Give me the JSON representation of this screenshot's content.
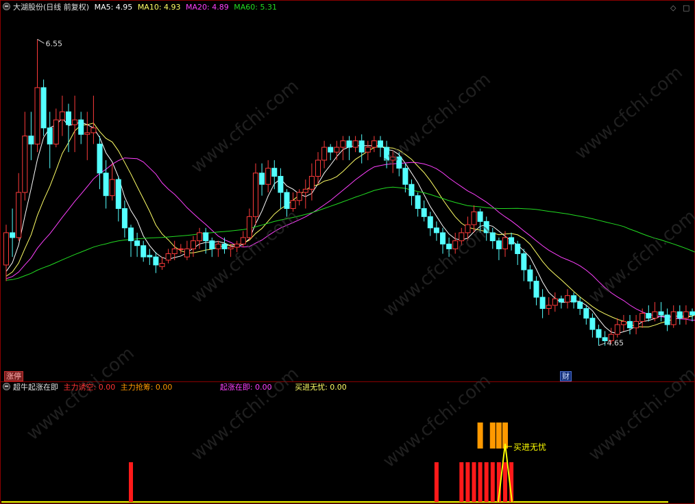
{
  "main_legend": {
    "title": "大湖股份(日线 前复权)",
    "ma5_label": "MA5: 4.95",
    "ma10_label": "MA10: 4.93",
    "ma20_label": "MA20: 4.89",
    "ma60_label": "MA60: 5.31"
  },
  "sub_legend": {
    "title": "超牛起涨在即",
    "zhuli_youkong": "主力诱空: 0.00",
    "zhuli_qiangchou": "主力抢筹: 0.00",
    "qizhang_zaiji": "起涨在即: 0.00",
    "maijin_wuyou": "买进无忧: 0.00"
  },
  "tags": {
    "zhangting": "涨停",
    "cai": "财"
  },
  "watermark": "www.cfchi.com",
  "colors": {
    "up": "#ff3b3b",
    "down": "#54ffff",
    "ma5": "#ffffff",
    "ma10": "#ffff66",
    "ma20": "#ff40ff",
    "ma60": "#22dd22",
    "red_bar": "#ff1a1a",
    "orange_bar": "#ff9900",
    "yellow_line": "#ffff00"
  },
  "chart_data": [
    {
      "type": "candlestick",
      "price_range": [
        4.5,
        6.7
      ],
      "high_label": "6.55",
      "low_label": "4.65",
      "candles": [
        [
          5.15,
          5.35,
          5.05,
          5.4
        ],
        [
          5.35,
          5.32,
          5.2,
          5.5
        ],
        [
          5.32,
          5.6,
          5.3,
          5.72
        ],
        [
          5.6,
          5.95,
          5.55,
          6.1
        ],
        [
          5.95,
          5.9,
          5.8,
          6.1
        ],
        [
          5.9,
          6.25,
          5.85,
          6.55
        ],
        [
          6.25,
          6.0,
          5.95,
          6.3
        ],
        [
          6.0,
          5.9,
          5.75,
          6.1
        ],
        [
          5.9,
          6.05,
          5.88,
          6.12
        ],
        [
          6.05,
          6.1,
          5.95,
          6.2
        ],
        [
          6.1,
          6.02,
          5.85,
          6.15
        ],
        [
          6.02,
          6.05,
          5.85,
          6.2
        ],
        [
          6.05,
          5.96,
          5.9,
          6.1
        ],
        [
          5.96,
          5.97,
          5.8,
          6.1
        ],
        [
          5.97,
          6.0,
          5.9,
          6.2
        ],
        [
          5.9,
          5.72,
          5.62,
          5.95
        ],
        [
          5.72,
          5.58,
          5.5,
          5.8
        ],
        [
          5.58,
          5.68,
          5.55,
          5.78
        ],
        [
          5.68,
          5.5,
          5.42,
          5.7
        ],
        [
          5.5,
          5.38,
          5.32,
          5.55
        ],
        [
          5.38,
          5.3,
          5.2,
          5.4
        ],
        [
          5.3,
          5.27,
          5.2,
          5.35
        ],
        [
          5.27,
          5.2,
          5.17,
          5.3
        ],
        [
          5.21,
          5.2,
          5.15,
          5.25
        ],
        [
          5.2,
          5.15,
          5.1,
          5.23
        ],
        [
          5.14,
          5.16,
          5.12,
          5.2
        ],
        [
          5.18,
          5.22,
          5.16,
          5.25
        ],
        [
          5.22,
          5.25,
          5.18,
          5.3
        ],
        [
          5.25,
          5.25,
          5.22,
          5.28
        ],
        [
          5.2,
          5.25,
          5.18,
          5.3
        ],
        [
          5.25,
          5.3,
          5.2,
          5.33
        ],
        [
          5.3,
          5.35,
          5.25,
          5.38
        ],
        [
          5.35,
          5.3,
          5.22,
          5.38
        ],
        [
          5.3,
          5.25,
          5.2,
          5.32
        ],
        [
          5.25,
          5.28,
          5.2,
          5.3
        ],
        [
          5.28,
          5.25,
          5.22,
          5.32
        ],
        [
          5.25,
          5.26,
          5.2,
          5.28
        ],
        [
          5.26,
          5.28,
          5.23,
          5.3
        ],
        [
          5.28,
          5.32,
          5.26,
          5.36
        ],
        [
          5.32,
          5.45,
          5.3,
          5.5
        ],
        [
          5.45,
          5.72,
          5.4,
          5.78
        ],
        [
          5.72,
          5.65,
          5.58,
          5.78
        ],
        [
          5.65,
          5.75,
          5.6,
          5.8
        ],
        [
          5.75,
          5.7,
          5.62,
          5.8
        ],
        [
          5.7,
          5.6,
          5.5,
          5.75
        ],
        [
          5.6,
          5.5,
          5.45,
          5.62
        ],
        [
          5.5,
          5.55,
          5.48,
          5.6
        ],
        [
          5.55,
          5.6,
          5.52,
          5.62
        ],
        [
          5.6,
          5.62,
          5.5,
          5.68
        ],
        [
          5.62,
          5.7,
          5.55,
          5.78
        ],
        [
          5.7,
          5.8,
          5.65,
          5.85
        ],
        [
          5.8,
          5.88,
          5.75,
          5.92
        ],
        [
          5.88,
          5.85,
          5.8,
          5.9
        ],
        [
          5.85,
          5.88,
          5.8,
          5.92
        ],
        [
          5.88,
          5.92,
          5.8,
          5.95
        ],
        [
          5.92,
          5.88,
          5.8,
          5.95
        ],
        [
          5.88,
          5.92,
          5.85,
          5.95
        ],
        [
          5.92,
          5.85,
          5.78,
          5.96
        ],
        [
          5.85,
          5.88,
          5.8,
          5.92
        ],
        [
          5.88,
          5.92,
          5.85,
          5.95
        ],
        [
          5.92,
          5.88,
          5.82,
          5.95
        ],
        [
          5.88,
          5.8,
          5.75,
          5.92
        ],
        [
          5.8,
          5.82,
          5.72,
          5.86
        ],
        [
          5.82,
          5.75,
          5.7,
          5.85
        ],
        [
          5.75,
          5.65,
          5.6,
          5.78
        ],
        [
          5.65,
          5.58,
          5.52,
          5.68
        ],
        [
          5.58,
          5.5,
          5.45,
          5.6
        ],
        [
          5.5,
          5.45,
          5.42,
          5.55
        ],
        [
          5.45,
          5.38,
          5.33,
          5.48
        ],
        [
          5.38,
          5.35,
          5.3,
          5.42
        ],
        [
          5.35,
          5.28,
          5.22,
          5.38
        ],
        [
          5.28,
          5.25,
          5.2,
          5.32
        ],
        [
          5.25,
          5.3,
          5.22,
          5.35
        ],
        [
          5.3,
          5.35,
          5.27,
          5.38
        ],
        [
          5.35,
          5.4,
          5.3,
          5.45
        ],
        [
          5.4,
          5.48,
          5.35,
          5.52
        ],
        [
          5.48,
          5.42,
          5.35,
          5.5
        ],
        [
          5.42,
          5.35,
          5.3,
          5.45
        ],
        [
          5.35,
          5.3,
          5.25,
          5.38
        ],
        [
          5.3,
          5.25,
          5.18,
          5.32
        ],
        [
          5.25,
          5.32,
          5.2,
          5.36
        ],
        [
          5.32,
          5.28,
          5.24,
          5.35
        ],
        [
          5.28,
          5.22,
          5.15,
          5.3
        ],
        [
          5.22,
          5.12,
          5.05,
          5.25
        ],
        [
          5.12,
          5.05,
          5.0,
          5.15
        ],
        [
          5.05,
          4.95,
          4.9,
          5.08
        ],
        [
          4.95,
          4.88,
          4.82,
          5.0
        ],
        [
          4.88,
          4.9,
          4.84,
          4.95
        ],
        [
          4.9,
          4.94,
          4.86,
          4.98
        ],
        [
          4.94,
          4.92,
          4.88,
          4.96
        ],
        [
          4.92,
          4.96,
          4.88,
          5.0
        ],
        [
          4.96,
          4.92,
          4.88,
          4.98
        ],
        [
          4.92,
          4.88,
          4.84,
          4.95
        ],
        [
          4.88,
          4.82,
          4.78,
          4.9
        ],
        [
          4.82,
          4.75,
          4.7,
          4.85
        ],
        [
          4.75,
          4.7,
          4.65,
          4.78
        ],
        [
          4.7,
          4.68,
          4.65,
          4.74
        ],
        [
          4.68,
          4.72,
          4.66,
          4.76
        ],
        [
          4.72,
          4.78,
          4.7,
          4.82
        ],
        [
          4.78,
          4.8,
          4.74,
          4.84
        ],
        [
          4.8,
          4.76,
          4.72,
          4.84
        ],
        [
          4.76,
          4.8,
          4.72,
          4.84
        ],
        [
          4.8,
          4.85,
          4.76,
          4.88
        ],
        [
          4.85,
          4.82,
          4.8,
          4.9
        ],
        [
          4.82,
          4.86,
          4.8,
          4.92
        ],
        [
          4.86,
          4.84,
          4.8,
          4.92
        ],
        [
          4.84,
          4.78,
          4.74,
          4.88
        ],
        [
          4.78,
          4.86,
          4.76,
          4.9
        ],
        [
          4.86,
          4.82,
          4.78,
          4.9
        ],
        [
          4.82,
          4.86,
          4.78,
          4.9
        ],
        [
          4.86,
          4.84,
          4.8,
          4.88
        ],
        [
          4.84,
          4.96,
          4.82,
          5.02
        ]
      ],
      "ma_lengths": [
        5,
        10,
        20,
        60
      ],
      "ma_start": [
        [
          5.15,
          5.15,
          5.15,
          5.05
        ],
        [
          5.15,
          5.15,
          5.15,
          5.05
        ],
        [
          5.15,
          5.15,
          5.15,
          5.05
        ],
        [
          5.15,
          5.15,
          5.15,
          5.05
        ]
      ]
    },
    {
      "type": "signal_bars",
      "red_bar_indices": [
        20,
        69,
        73,
        74,
        75,
        76,
        77,
        78,
        79,
        80,
        81
      ],
      "orange_bar_indices": [
        76,
        78,
        79,
        80
      ],
      "yellow_spike_index": 80,
      "spike_label": "买进无忧",
      "ylim": [
        0,
        1
      ]
    }
  ]
}
